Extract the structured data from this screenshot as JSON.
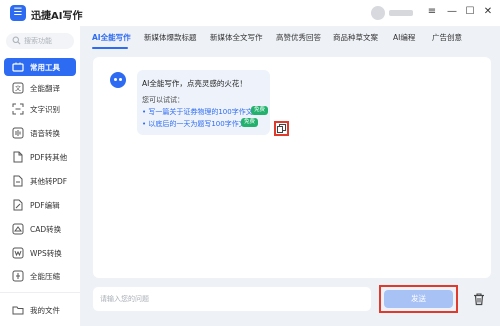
{
  "app": {
    "logo_glyph": "☰",
    "title": "迅捷AI写作"
  },
  "window": {
    "menu": "≡",
    "minimize": "—",
    "maximize": "☐",
    "close": "✕"
  },
  "sidebar": {
    "search_placeholder": "搜索功能",
    "items": [
      {
        "label": "常用工具",
        "icon": "toolbox-icon",
        "active": true
      },
      {
        "label": "全能翻译",
        "icon": "translate-icon"
      },
      {
        "label": "文字识别",
        "icon": "text-scan-icon"
      },
      {
        "label": "语音转换",
        "icon": "voice-icon"
      },
      {
        "label": "PDF转其他",
        "icon": "pdf-convert-icon"
      },
      {
        "label": "其他转PDF",
        "icon": "to-pdf-icon"
      },
      {
        "label": "PDF编辑",
        "icon": "pdf-edit-icon"
      },
      {
        "label": "CAD转换",
        "icon": "cad-icon"
      },
      {
        "label": "WPS转换",
        "icon": "wps-icon"
      },
      {
        "label": "全能压缩",
        "icon": "compress-icon"
      }
    ],
    "my_files": "我的文件"
  },
  "tabs": [
    {
      "label": "AI全能写作",
      "active": true
    },
    {
      "label": "新媒体爆款标题"
    },
    {
      "label": "新媒体全文写作"
    },
    {
      "label": "高赞优秀回答"
    },
    {
      "label": "商品种草文案"
    },
    {
      "label": "AI编程"
    },
    {
      "label": "广告创意"
    }
  ],
  "chat": {
    "greeting": "AI全能写作，点亮灵感的火花！",
    "try_label": "您可以试试：",
    "suggestions": [
      {
        "text": "• 写一篇关于证券物理的100字作文",
        "badge": "免费"
      },
      {
        "text": "• 以底后的一天为题写100字作文",
        "badge": "免费"
      }
    ]
  },
  "input": {
    "placeholder": "请输入您的问题"
  },
  "send_label": "发送",
  "colors": {
    "accent": "#2d6bf2",
    "highlight_border": "#e03a2c",
    "badge_green": "#23b26d",
    "send_disabled": "#a9c2f5"
  }
}
